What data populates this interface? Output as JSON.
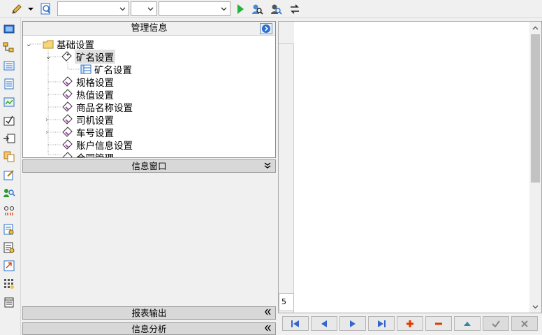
{
  "toolbar": {
    "combo1_value": "",
    "combo2_value": "",
    "combo3_value": "",
    "icons": [
      "pencil-icon",
      "dropdown-arrow-icon",
      "search-doc-icon",
      "run-icon",
      "find-user-icon",
      "find-next-icon",
      "refresh-icon"
    ]
  },
  "sidebar": {
    "icons": [
      "screen-icon",
      "org-chart-icon",
      "list-icon",
      "document-icon",
      "chart-icon",
      "check-box-icon",
      "export-icon",
      "copy-icon",
      "edit-icon",
      "search-user-icon",
      "dots-icon",
      "report-icon",
      "report2-icon",
      "move-icon",
      "grid-icon",
      "stack-icon"
    ]
  },
  "manage_panel": {
    "title": "管理信息",
    "tree": [
      {
        "label": "基础设置",
        "type": "folder",
        "expanded": true
      },
      {
        "label": "矿名设置",
        "type": "node",
        "expanded": true,
        "selected": true
      },
      {
        "label": "矿名设置",
        "type": "leaf"
      },
      {
        "label": "规格设置",
        "type": "node"
      },
      {
        "label": "热值设置",
        "type": "node"
      },
      {
        "label": "商品名称设置",
        "type": "node"
      },
      {
        "label": "司机设置",
        "type": "node",
        "collapsed": true
      },
      {
        "label": "车号设置",
        "type": "node",
        "collapsed": true
      },
      {
        "label": "账户信息设置",
        "type": "node"
      },
      {
        "label": "合同管理",
        "type": "node"
      }
    ]
  },
  "sections": {
    "info_window": "信息窗口",
    "report_output": "报表输出",
    "info_analysis": "信息分析"
  },
  "right_pane": {
    "row_indicator": "5"
  },
  "nav": {
    "first": "|◀",
    "prev": "◀",
    "next": "▶",
    "last": "▶|",
    "add": "+",
    "delete": "−",
    "up": "▲",
    "confirm": "✓",
    "cancel": "✕"
  },
  "colors": {
    "accent_blue": "#2a6fc9",
    "add_red": "#e03a00",
    "nav_blue": "#3366cc"
  }
}
